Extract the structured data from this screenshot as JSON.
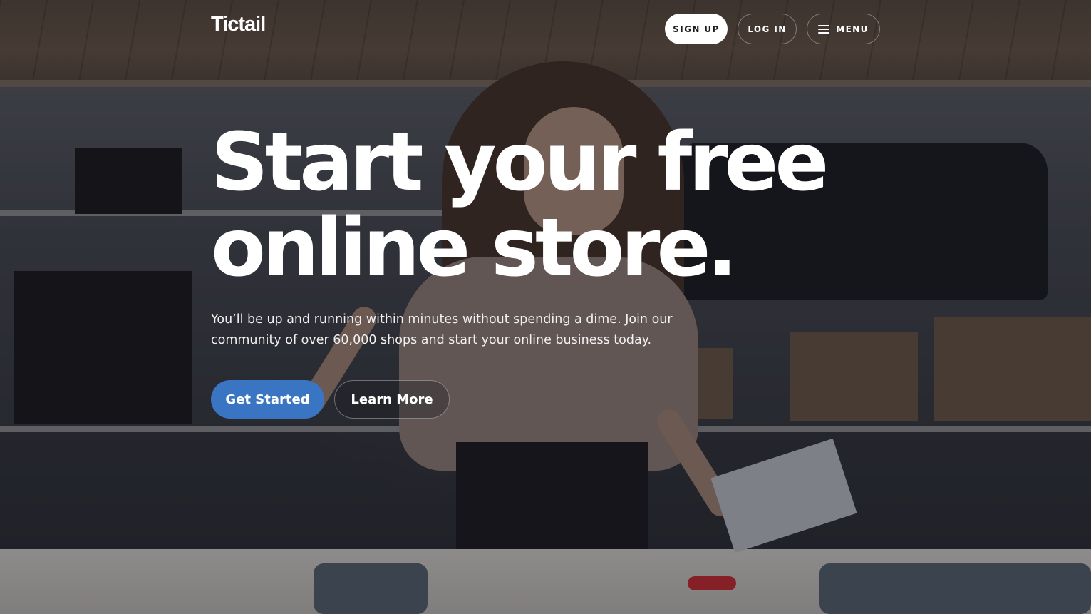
{
  "header": {
    "logo": "Tictail",
    "signup_label": "SIGN UP",
    "login_label": "LOG IN",
    "menu_label": "MENU"
  },
  "hero": {
    "headline_line1": "Start your free",
    "headline_line2": "online store.",
    "subtext": "You’ll be up and running within minutes without spending a dime. Join our community of over 60,000 shops and start your online business today.",
    "primary_cta": "Get Started",
    "secondary_cta": "Learn More"
  },
  "colors": {
    "primary_button": "#3a75c4",
    "text": "#ffffff"
  },
  "icons": {
    "menu": "hamburger-icon"
  }
}
